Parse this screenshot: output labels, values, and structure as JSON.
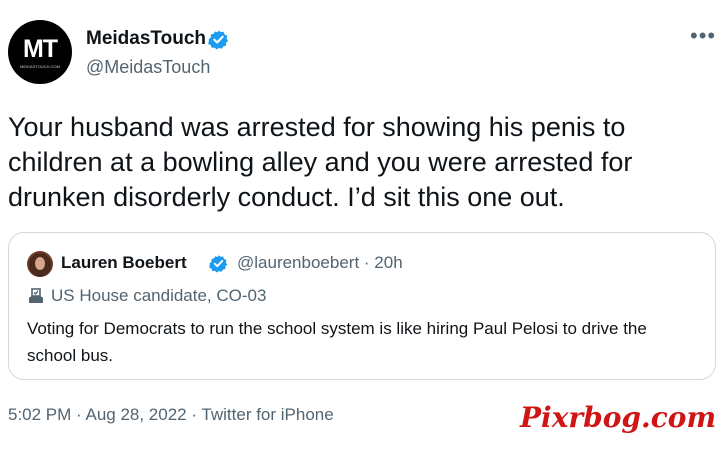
{
  "author": {
    "avatar_text": "MT",
    "avatar_subtext": "MEIDASTOUCH.COM",
    "name": "MeidasTouch",
    "handle": "@MeidasTouch",
    "verified": true
  },
  "more_icon": "more-horizontal-icon",
  "tweet": {
    "text": "Your husband was arrested for showing his penis to children at a bowling alley and you were arrested for drunken disorderly conduct. I’d sit this one out."
  },
  "quoted_tweet": {
    "name": "Lauren Boebert",
    "verified": true,
    "handle_time": "@laurenboebert · 20h",
    "label_icon": "ballot-box-icon",
    "label": "US House candidate, CO-03",
    "text": "Voting for Democrats to run the school system is like hiring Paul Pelosi to drive the school bus."
  },
  "meta": "5:02 PM · Aug 28, 2022 · Twitter for iPhone",
  "watermark": "Pixrbog.com",
  "colors": {
    "verified": "#1d9bf0",
    "secondary_text": "#536471",
    "watermark": "#d01515"
  }
}
